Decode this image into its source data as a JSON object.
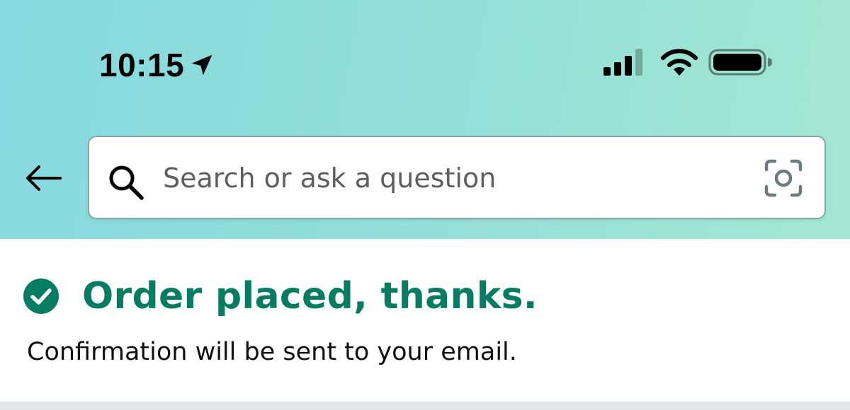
{
  "status_bar": {
    "time": "10:15",
    "icons": [
      "location-arrow-icon",
      "cellular-signal-icon",
      "wifi-icon",
      "battery-icon"
    ]
  },
  "search": {
    "placeholder": "Search or ask a question",
    "value": "",
    "back_icon": "back-arrow-icon",
    "search_icon": "search-icon",
    "camera_icon": "camera-lens-icon"
  },
  "confirmation": {
    "title": "Order placed, thanks.",
    "message": "Confirmation will be sent to your email.",
    "icon": "check-circle-icon"
  },
  "colors": {
    "header_gradient_start": "#86d9df",
    "header_gradient_end": "#a4e7d2",
    "success_green": "#067d62",
    "text_dark": "#0f1111",
    "placeholder_gray": "#5b5f63"
  }
}
